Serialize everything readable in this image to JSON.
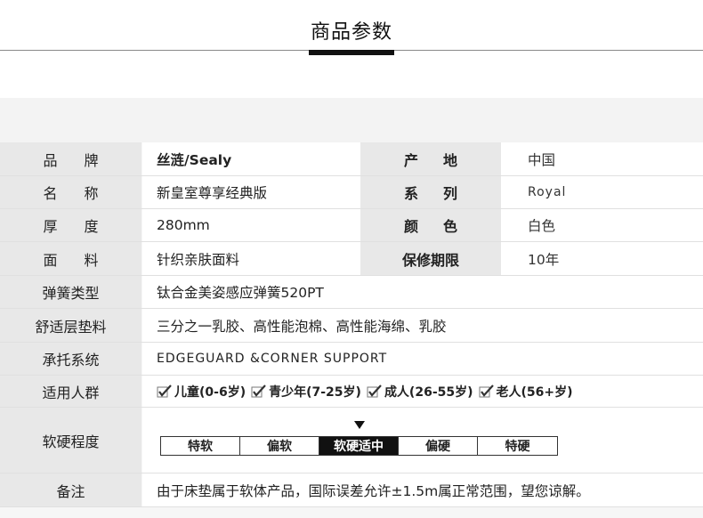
{
  "header": {
    "title": "商品参数"
  },
  "rows": {
    "brand": {
      "label": "品牌",
      "value": "丝涟/Sealy",
      "label2": "产地",
      "value2": "中国"
    },
    "name": {
      "label": "名称",
      "value": "新皇室尊享经典版",
      "label2": "系列",
      "value2": "Royal"
    },
    "thickness": {
      "label": "厚度",
      "value": "280mm",
      "label2": "颜色",
      "value2": "白色"
    },
    "fabric": {
      "label": "面料",
      "value": "针织亲肤面料",
      "label2": "保修期限",
      "value2": "10年"
    },
    "spring": {
      "label": "弹簧类型",
      "value": "钛合金美姿感应弹簧520PT"
    },
    "comfort": {
      "label": "舒适层垫料",
      "value": "三分之一乳胶、高性能泡棉、高性能海绵、乳胶"
    },
    "support": {
      "label": "承托系统",
      "value": "EDGEGUARD &CORNER SUPPORT"
    },
    "crowd": {
      "label": "适用人群",
      "items": [
        "儿童(0-6岁)",
        "青少年(7-25岁)",
        "成人(26-55岁)",
        "老人(56+岁)"
      ]
    },
    "firmness": {
      "label": "软硬程度",
      "levels": [
        "特软",
        "偏软",
        "软硬适中",
        "偏硬",
        "特硬"
      ],
      "selected_index": 2
    },
    "note": {
      "label": "备注",
      "value": "由于床垫属于软体产品，国际误差允许±1.5m属正常范围，望您谅解。"
    }
  }
}
